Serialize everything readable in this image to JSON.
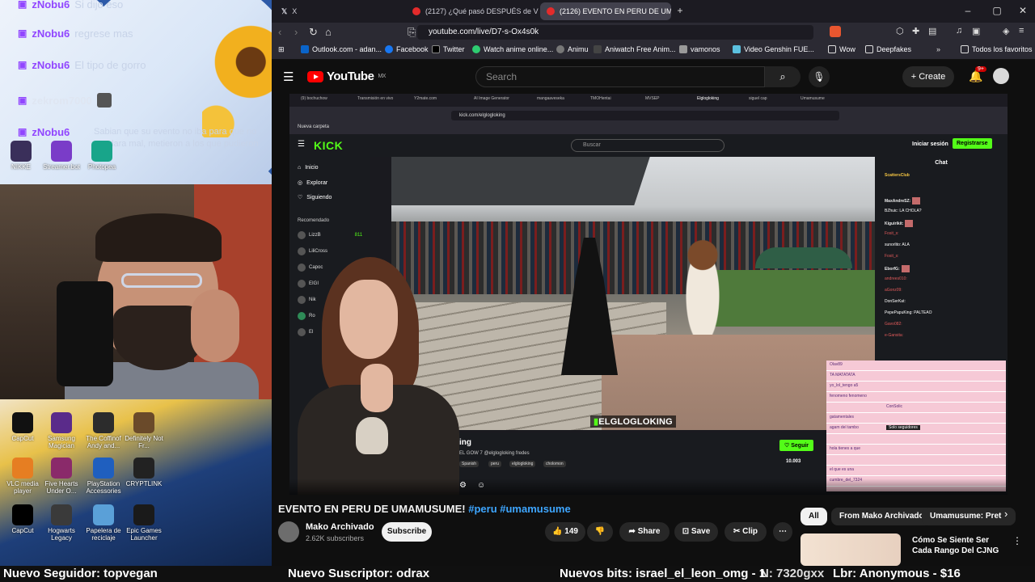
{
  "overlay": {
    "chat": [
      {
        "user": "zNobu6",
        "msg": "Si dijo eso"
      },
      {
        "user": "zNobu6",
        "msg": "regrese mas"
      },
      {
        "user": "zNobu6",
        "msg": "El tipo de gorro"
      },
      {
        "user": "zekrom7000",
        "msg": ""
      },
      {
        "user": "zNobu6",
        "msg": "Sabian que su evento no iba para que no quedara mal, metieron a los que pudieron"
      }
    ],
    "top_icons": [
      "NIKKE",
      "Streamer.bot",
      "Photopea"
    ],
    "desktop_icons": [
      {
        "label": "CapCut",
        "color": "#111111"
      },
      {
        "label": "Samsung Magician",
        "color": "#5a2b8a"
      },
      {
        "label": "The Coffinof Andy and...",
        "color": "#2c2c2c"
      },
      {
        "label": "Definitely Not Fr...",
        "color": "#6a4a2a"
      },
      {
        "label": "VLC media player",
        "color": "#e67e22"
      },
      {
        "label": "Five Hearts Under O...",
        "color": "#8a2a6a"
      },
      {
        "label": "PlayStation Accessories",
        "color": "#1f5fbf"
      },
      {
        "label": "CRYPTLINK",
        "color": "#222222"
      },
      {
        "label": "CapCut",
        "color": "#000000"
      },
      {
        "label": "Hogwarts Legacy",
        "color": "#3a3a3a"
      },
      {
        "label": "Papelera de reciclaje",
        "color": "#5aa0d8"
      },
      {
        "label": "Epic Games Launcher",
        "color": "#1a1a1a"
      }
    ]
  },
  "browser": {
    "tabs": [
      {
        "label": "X",
        "active": false
      },
      {
        "label": "(2127) ¿Qué pasó DESPUÉS de VOLV",
        "active": false
      },
      {
        "label": "(2126) EVENTO EN PERU DE UMA",
        "active": true
      }
    ],
    "url": "youtube.com/live/D7-s-Ox4s0k",
    "bookmarks": [
      "Outlook.com - adan...",
      "Facebook",
      "Twitter",
      "Watch anime online...",
      "Animu",
      "Aniwatch Free Anim...",
      "vamonos",
      "Video Genshin FUE...",
      "Wow",
      "Deepfakes",
      "Todos los favoritos"
    ]
  },
  "youtube": {
    "region": "MX",
    "search_placeholder": "Search",
    "create_label": "Create",
    "notif_count": "9+",
    "video_title": "EVENTO EN PERU DE UMAMUSUME!",
    "video_tags": "#peru #umamusume",
    "channel": "Mako Archivado",
    "subscribers": "2.62K subscribers",
    "subscribe_label": "Subscribe",
    "likes": "149",
    "share_label": "Share",
    "save_label": "Save",
    "clip_label": "Clip",
    "chips": [
      "All",
      "From Mako Archivado",
      "Umamusume: Pret"
    ],
    "rec_title": "Cómo Se Siente Ser Cada Rango Del CJNG"
  },
  "kick": {
    "url": "kick.com/elglogloking",
    "bookmark": "Nueva carpeta",
    "logo": "KICK",
    "search_placeholder": "Buscar",
    "login": "Iniciar sesión",
    "register": "Registrarse",
    "nav": [
      "Inicio",
      "Explorar",
      "Siguiendo"
    ],
    "recommended_label": "Recomendado",
    "recommended": [
      {
        "name": "LizzB",
        "sub": "ARC Raiders",
        "viewers": "811"
      },
      {
        "name": "LiliCross",
        "sub": "Conversar"
      },
      {
        "name": "Capoc",
        "sub": ""
      },
      {
        "name": "EIGI",
        "sub": ""
      },
      {
        "name": "Nik",
        "sub": ""
      },
      {
        "name": "Ro",
        "sub": ""
      },
      {
        "name": "El",
        "sub": ""
      }
    ],
    "watermark": "ELGLOGLOKING",
    "streamer_name": "ing",
    "stream_title": "EL GOW 7 @elglogloking fredes",
    "stream_tags": [
      "Spanish",
      "peru",
      "elglogloking",
      "cholomon"
    ],
    "follow": "Seguir",
    "viewers": "10.003",
    "chat_title": "Chat",
    "chat_pinned": "ScattersClub",
    "chat_lines": [
      "MaxAndreSZ:",
      "BZhuic: LA CHOLA?",
      "Kiguirikit:",
      "Fosit_s:",
      "sunorlito: ALA",
      "Fosit_s:",
      "EborfG:",
      "andrees010:",
      "aGonz09:",
      "DonSerKat:",
      "PepePapuKing: PALTEAO",
      "Gavo082:",
      "e-Gansita:"
    ],
    "pink_chat": [
      "Olav89",
      "TA MATATATA",
      "yo_lol_tengo a5",
      "fenomeno fenomeno",
      "ConSolic",
      "gatamentales",
      "agam del tambo",
      "Solo seguidores",
      "hola tienes a que",
      "el que es una",
      "cumbre_del_7324"
    ]
  },
  "ticker": [
    "Nuevo Seguidor: topvegan",
    "Nuevo Suscriptor: odrax",
    "Nuevos bits: israel_el_leon_omg - 1",
    "N: 7320gxx",
    "Lbr: Anonymous - $16"
  ]
}
